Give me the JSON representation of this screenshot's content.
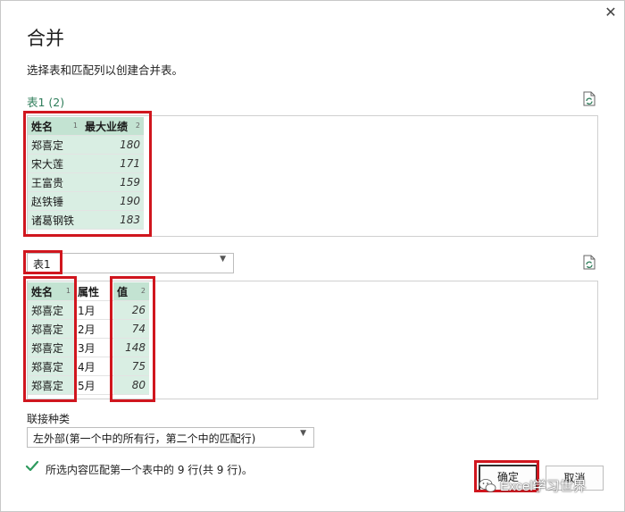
{
  "dialog": {
    "close_glyph": "✕",
    "title": "合并",
    "subtitle": "选择表和匹配列以创建合并表。"
  },
  "table1": {
    "name": "表1 (2)",
    "columns": [
      {
        "label": "姓名",
        "index": "1"
      },
      {
        "label": "最大业绩",
        "index": "2"
      }
    ],
    "rows": [
      [
        "郑喜定",
        "180"
      ],
      [
        "宋大莲",
        "171"
      ],
      [
        "王富贵",
        "159"
      ],
      [
        "赵铁锤",
        "190"
      ],
      [
        "诸葛钢铁",
        "183"
      ]
    ]
  },
  "table2": {
    "selected": "表1",
    "columns": [
      {
        "label": "姓名",
        "index": "1"
      },
      {
        "label": "属性",
        "index": ""
      },
      {
        "label": "值",
        "index": "2"
      }
    ],
    "rows": [
      [
        "郑喜定",
        "1月",
        "26"
      ],
      [
        "郑喜定",
        "2月",
        "74"
      ],
      [
        "郑喜定",
        "3月",
        "148"
      ],
      [
        "郑喜定",
        "4月",
        "75"
      ],
      [
        "郑喜定",
        "5月",
        "80"
      ]
    ]
  },
  "join": {
    "label": "联接种类",
    "selected": "左外部(第一个中的所有行，第二个中的匹配行)"
  },
  "status": {
    "text": "所选内容匹配第一个表中的 9 行(共 9 行)。"
  },
  "buttons": {
    "ok": "确定",
    "cancel": "取消"
  },
  "watermark": {
    "text": "Excel学习世界"
  },
  "colors": {
    "accent_green": "#2e7d5a",
    "selected_column": "#d9eee3",
    "highlight_red": "#d0161e"
  }
}
